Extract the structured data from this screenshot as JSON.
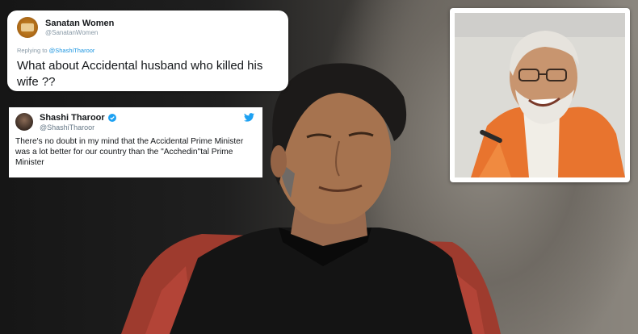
{
  "reply_tweet": {
    "display_name": "Sanatan Women",
    "handle": "@SanatanWomen",
    "replying_to_prefix": "Replying to ",
    "replying_to_handle": "@ShashiTharoor",
    "text": "What about Accidental husband who killed his wife ??"
  },
  "original_tweet": {
    "display_name": "Shashi Tharoor",
    "handle": "@ShashiTharoor",
    "verified": true,
    "text": "There's no doubt in my mind that the Accidental Prime Minister was a lot better for our country than the \"Acchedin\"tal Prime Minister"
  },
  "colors": {
    "twitter_blue": "#1da1f2",
    "mention_blue": "#1b95e0",
    "shawl_orange": "#e8742e"
  }
}
